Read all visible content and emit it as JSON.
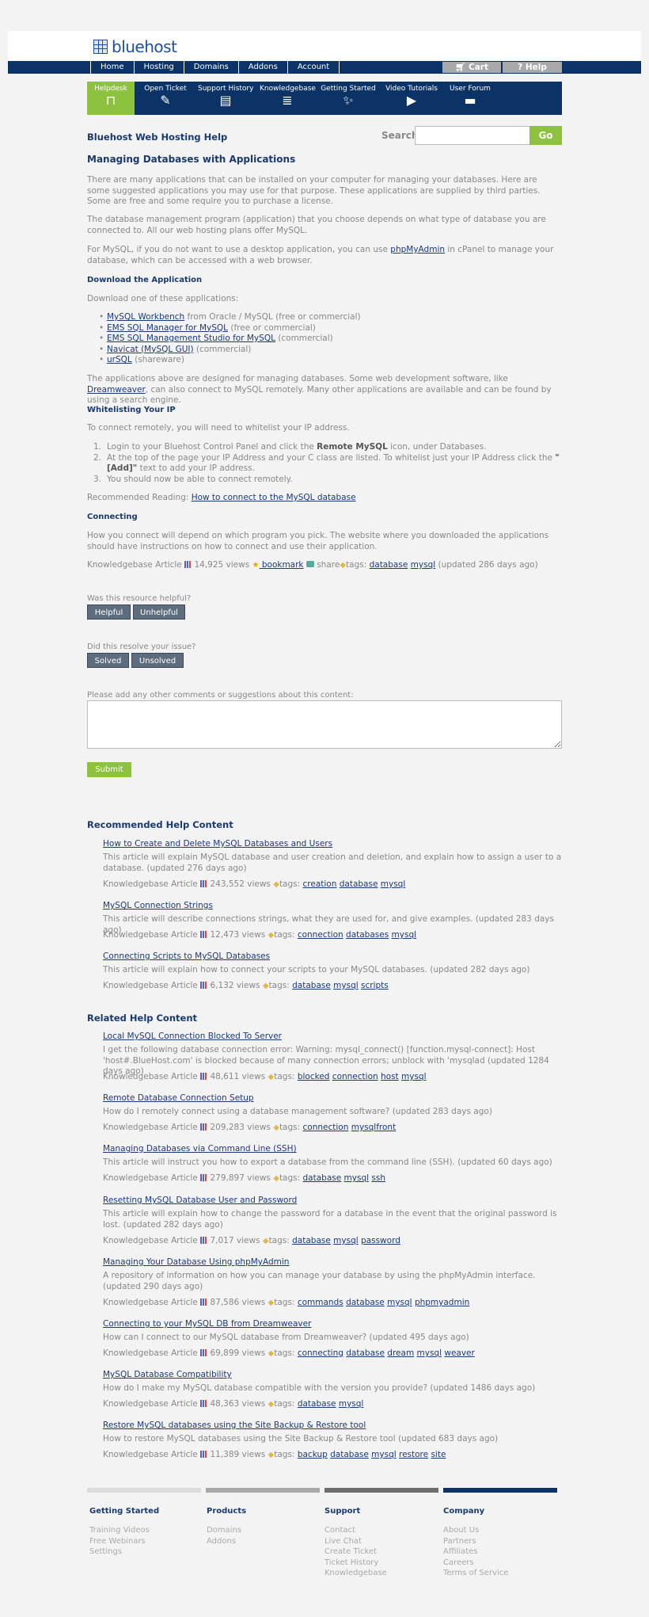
{
  "header": {
    "logo_text": "bluehost"
  },
  "topnav": {
    "items": [
      "Home",
      "Hosting",
      "Domains",
      "Addons",
      "Account"
    ],
    "cart": "Cart",
    "help": "Help"
  },
  "helpnav": {
    "items": [
      {
        "label": "Helpdesk",
        "icon": "desk-icon"
      },
      {
        "label": "Open Ticket",
        "icon": "ticket-icon"
      },
      {
        "label": "Support History",
        "icon": "history-icon"
      },
      {
        "label": "Knowledgebase",
        "icon": "books-icon"
      },
      {
        "label": "Getting Started",
        "icon": "wand-icon"
      },
      {
        "label": "Video Tutorials",
        "icon": "play-icon"
      },
      {
        "label": "User Forum",
        "icon": "chat-icon"
      }
    ]
  },
  "search": {
    "title": "Bluehost Web Hosting Help",
    "label": "Search",
    "go": "Go"
  },
  "article": {
    "title": "Managing Databases with Applications",
    "p1": "There are many applications that can be installed on your computer for managing your databases. Here are some suggested applications you may use for that purpose. These applications are supplied by third parties. Some are free and some require you to purchase a license.",
    "p2": "The database management program (application) that you choose depends on what type of database you are connected to. All our web hosting plans offer MySQL.",
    "p3_a": "For MySQL, if you do not want to use a desktop application, you can use ",
    "p3_link": "phpMyAdmin",
    "p3_b": " in cPanel to manage your database, which can be accessed with a web browser.",
    "h_download": "Download the Application",
    "download_intro": "Download one of these applications:",
    "apps": [
      {
        "link": "MySQL Workbench",
        "rest": " from Oracle / MySQL (free or commercial)"
      },
      {
        "link": "EMS SQL Manager for MySQL",
        "rest": " (free or commercial)"
      },
      {
        "link": "EMS SQL Management Studio for MySQL",
        "rest": " (commercial)"
      },
      {
        "link": "Navicat (MySQL GUI)",
        "rest": " (commercial)"
      },
      {
        "link": "urSQL",
        "rest": " (shareware)"
      }
    ],
    "p4_a": "The applications above are designed for managing databases. Some web development software, like ",
    "p4_link": "Dreamweaver",
    "p4_b": ", can also connect to MySQL remotely. Many other applications are available and can be found by using a search engine.",
    "h_whitelist": "Whitelisting Your IP",
    "whitelist_intro": "To connect remotely, you will need to whitelist your IP address.",
    "steps": [
      {
        "a": "Login to your Bluehost Control Panel and click the ",
        "b": "Remote MySQL",
        "c": " icon, under Databases."
      },
      {
        "a": "At the top of the page your IP Address and your C class are listed. To whitelist just your IP Address click the ",
        "b": "\"[Add]\"",
        "c": " text to add your IP address."
      },
      {
        "a": "You should now be able to connect remotely.",
        "b": "",
        "c": ""
      }
    ],
    "rec_reading_label": "Recommended Reading: ",
    "rec_reading_link": "How to connect to the MySQL database",
    "h_connecting": "Connecting",
    "connecting_text": "How you connect will depend on which program you pick. The website where you downloaded the applications should have instructions on how to connect and use their application.",
    "meta_prefix": "Knowledgebase Article",
    "meta_views": "14,925 views",
    "meta_bookmark": " bookmark",
    "meta_share": "share",
    "meta_tags_label": "tags:",
    "meta_tags": [
      "database",
      "mysql"
    ],
    "meta_updated": "(updated 286 days ago)"
  },
  "feedback": {
    "q1": "Was this resource helpful?",
    "helpful": "Helpful",
    "unhelpful": "Unhelpful",
    "q2": "Did this resolve your issue?",
    "solved": "Solved",
    "unsolved": "Unsolved",
    "comment_label": "Please add any other comments or suggestions about this content:",
    "submit": "Submit"
  },
  "recommended": {
    "title": "Recommended Help Content",
    "items": [
      {
        "title": "How to Create and Delete MySQL Databases and Users",
        "desc": "This article will explain MySQL database and user creation and deletion, and explain how to assign a user to a database. (updated 276 days ago)",
        "views": "243,552 views",
        "tags": [
          "creation",
          "database",
          "mysql"
        ]
      },
      {
        "title": "MySQL Connection Strings",
        "desc": "This article will describe connections strings, what they are used for, and give examples. (updated 283 days ago)",
        "views": "12,473 views",
        "tags": [
          "connection",
          "databases",
          "mysql"
        ]
      },
      {
        "title": "Connecting Scripts to MySQL Databases",
        "desc": "This article will explain how to connect your scripts to your MySQL databases. (updated 282 days ago)",
        "views": "6,132 views",
        "tags": [
          "database",
          "mysql",
          "scripts"
        ]
      }
    ]
  },
  "related": {
    "title": "Related Help Content",
    "items": [
      {
        "title": "Local MySQL Connection Blocked To Server",
        "desc": "I get the following database connection error: Warning: mysql_connect() [function.mysql-connect]: Host 'host#.BlueHost.com' is blocked because of many connection errors; unblock with 'mysqlad (updated 1284 days ago)",
        "views": "48,611 views",
        "tags": [
          "blocked",
          "connection",
          "host",
          "mysql"
        ]
      },
      {
        "title": "Remote Database Connection Setup",
        "desc": "How do I remotely connect using a database management software? (updated 283 days ago)",
        "views": "209,283 views",
        "tags": [
          "connection",
          "mysqlfront"
        ]
      },
      {
        "title": "Managing Databases via Command Line (SSH)",
        "desc": "This article will instruct you how to export a database from the command line (SSH). (updated 60 days ago)",
        "views": "279,897 views",
        "tags": [
          "database",
          "mysql",
          "ssh"
        ]
      },
      {
        "title": "Resetting MySQL Database User and Password",
        "desc": "This article will explain how to change the password for a database in the event that the original password is lost. (updated 282 days ago)",
        "views": "7,017 views",
        "tags": [
          "database",
          "mysql",
          "password"
        ]
      },
      {
        "title": "Managing Your Database Using phpMyAdmin",
        "desc": "A repository of information on how you can manage your database by using the phpMyAdmin interface. (updated 290 days ago)",
        "views": "87,586 views",
        "tags": [
          "commands",
          "database",
          "mysql",
          "phpmyadmin"
        ]
      },
      {
        "title": "Connecting to your MySQL DB from Dreamweaver",
        "desc": "How can I connect to our MySQL database from Dreamweaver? (updated 495 days ago)",
        "views": "69,899 views",
        "tags": [
          "connecting",
          "database",
          "dream",
          "mysql",
          "weaver"
        ]
      },
      {
        "title": "MySQL Database Compatibility",
        "desc": "How do I make my MySQL database compatible with the version you provide? (updated 1486 days ago)",
        "views": "48,363 views",
        "tags": [
          "database",
          "mysql"
        ]
      },
      {
        "title": "Restore MySQL databases using the Site Backup & Restore tool",
        "desc": "How to restore MySQL databases using the Site Backup & Restore tool (updated 683 days ago)",
        "views": "11,389 views",
        "tags": [
          "backup",
          "database",
          "mysql",
          "restore",
          "site"
        ]
      }
    ]
  },
  "footer": {
    "bar_colors": [
      "#dcdcdc",
      "#a9a9a9",
      "#6e6e6e",
      "#0c3366"
    ],
    "columns": [
      {
        "title": "Getting Started",
        "links": [
          "Training Videos",
          "Free Webinars",
          "Settings"
        ]
      },
      {
        "title": "Products",
        "links": [
          "Domains",
          "Addons"
        ]
      },
      {
        "title": "Support",
        "links": [
          "Contact",
          "Live Chat",
          "Create Ticket",
          "Ticket History",
          "Knowledgebase"
        ]
      },
      {
        "title": "Company",
        "links": [
          "About Us",
          "Partners",
          "Affiliates",
          "Careers",
          "Terms of Service"
        ]
      }
    ]
  }
}
